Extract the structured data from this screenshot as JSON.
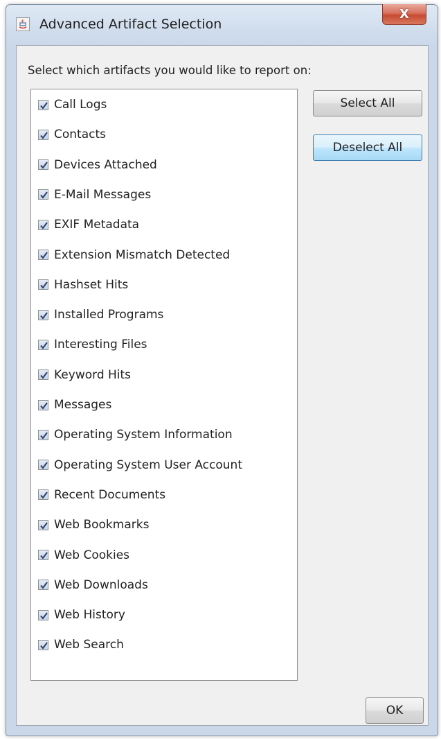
{
  "window": {
    "title": "Advanced Artifact Selection",
    "close_label": "X"
  },
  "prompt": "Select which artifacts you would like to report on:",
  "artifacts": [
    {
      "label": "Call Logs",
      "checked": true
    },
    {
      "label": "Contacts",
      "checked": true
    },
    {
      "label": "Devices Attached",
      "checked": true
    },
    {
      "label": "E-Mail Messages",
      "checked": true
    },
    {
      "label": "EXIF Metadata",
      "checked": true
    },
    {
      "label": "Extension Mismatch Detected",
      "checked": true
    },
    {
      "label": "Hashset Hits",
      "checked": true
    },
    {
      "label": "Installed Programs",
      "checked": true
    },
    {
      "label": "Interesting Files",
      "checked": true
    },
    {
      "label": "Keyword Hits",
      "checked": true
    },
    {
      "label": "Messages",
      "checked": true
    },
    {
      "label": "Operating System Information",
      "checked": true
    },
    {
      "label": "Operating System User Account",
      "checked": true
    },
    {
      "label": "Recent Documents",
      "checked": true
    },
    {
      "label": "Web Bookmarks",
      "checked": true
    },
    {
      "label": "Web Cookies",
      "checked": true
    },
    {
      "label": "Web Downloads",
      "checked": true
    },
    {
      "label": "Web History",
      "checked": true
    },
    {
      "label": "Web Search",
      "checked": true
    }
  ],
  "buttons": {
    "select_all": "Select All",
    "deselect_all": "Deselect All",
    "ok": "OK"
  }
}
